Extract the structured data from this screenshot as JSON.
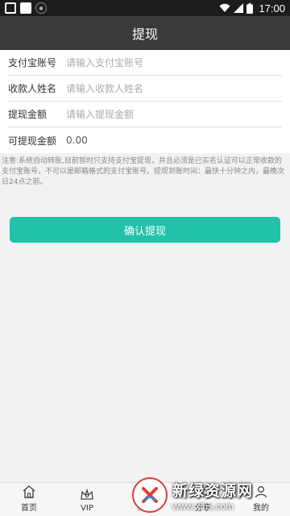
{
  "status_bar": {
    "time": "17:00",
    "icons": [
      "app-square-icon",
      "app-square-icon",
      "app-badge-icon",
      "wifi-icon",
      "signal-icon",
      "battery-icon"
    ]
  },
  "header": {
    "title": "提现"
  },
  "form": {
    "alipay_account": {
      "label": "支付宝账号",
      "placeholder": "请输入支付宝账号"
    },
    "payee_name": {
      "label": "收款人姓名",
      "placeholder": "请输入收款人姓名"
    },
    "amount": {
      "label": "提现金额",
      "placeholder": "请输入提现金额"
    },
    "available": {
      "label": "可提现金额",
      "value": "0.00"
    }
  },
  "notice": "注意:系统自动转账,目前暂时只支持支付宝提现，并且必须是已实名认证可以正常收款的支付宝账号，不可以是邮箱格式的支付宝账号。提现到账时间：最快十分钟之内，最晚次日24点之前。",
  "confirm_button": {
    "label": "确认提现",
    "color": "#21c2a8"
  },
  "tabbar": {
    "items": [
      {
        "label": "首页",
        "icon": "home-icon"
      },
      {
        "label": "VIP",
        "icon": "crown-icon"
      },
      {
        "label": "提现",
        "icon": "withdraw-icon",
        "active": true
      },
      {
        "label": "分享",
        "icon": "share-icon"
      },
      {
        "label": "我的",
        "icon": "profile-icon"
      }
    ]
  },
  "watermark": {
    "title": "新绿资源网",
    "url": "www.xlhs.com"
  }
}
